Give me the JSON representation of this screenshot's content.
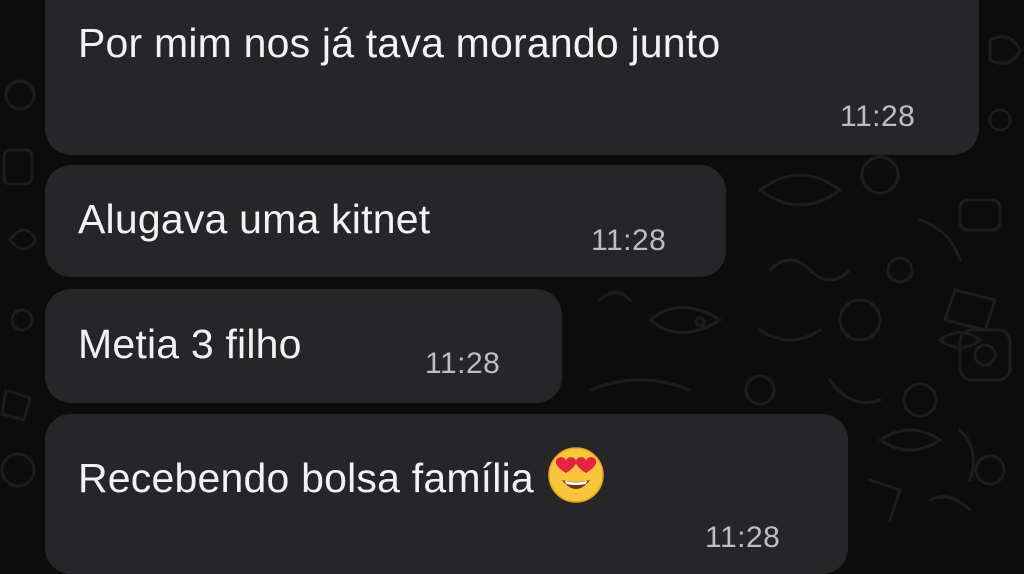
{
  "chat": {
    "messages": [
      {
        "text": "Por mim nos já tava morando junto",
        "time": "11:28"
      },
      {
        "text": "Alugava uma kitnet",
        "time": "11:28"
      },
      {
        "text": "Metia 3 filho",
        "time": "11:28"
      },
      {
        "text": "Recebendo bolsa família",
        "time": "11:28",
        "emoji": "heart-eyes-emoji"
      }
    ]
  },
  "colors": {
    "background": "#0c0c0d",
    "bubble": "#262628",
    "text": "#f2f2f4",
    "time": "#bdbdc2"
  }
}
